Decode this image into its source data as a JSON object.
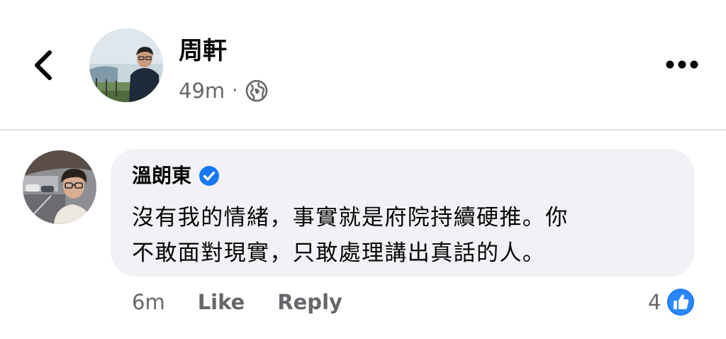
{
  "post": {
    "author": "周軒",
    "time": "49m",
    "separator": "·",
    "privacy_icon": "globe-icon",
    "back_icon": "chevron-left-icon",
    "more_icon": "more-horizontal-icon"
  },
  "comment": {
    "author": "溫朗東",
    "verified_icon": "verified-badge-icon",
    "text_lines": [
      "沒有我的情緒，事實就是府院持續硬推。你",
      "不敢面對現實，只敢處理講出真話的人。"
    ],
    "time": "6m",
    "like_label": "Like",
    "reply_label": "Reply",
    "reaction_count": "4",
    "reaction_icon": "like-reaction-icon"
  },
  "colors": {
    "bubble": "#f0f2f5",
    "secondary_text": "#65676b",
    "primary_text": "#050505",
    "brand_blue": "#1877f2",
    "divider": "#dadde1"
  }
}
